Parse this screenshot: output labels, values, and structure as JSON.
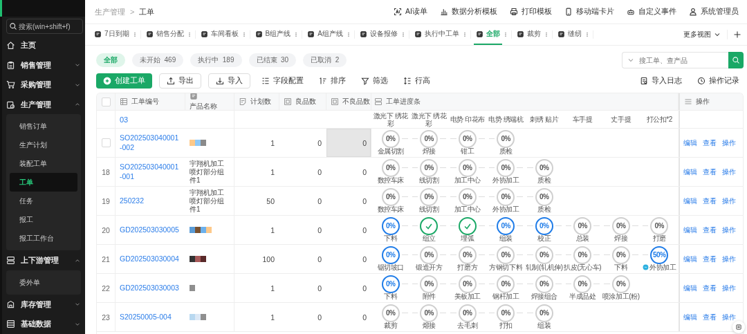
{
  "sidebar": {
    "search": {
      "placeholder": "搜索(win+shift+f)"
    },
    "items": [
      {
        "label": "主页",
        "kind": "link"
      },
      {
        "label": "销售管理",
        "kind": "group",
        "expanded": false
      },
      {
        "label": "采购管理",
        "kind": "group",
        "expanded": false
      },
      {
        "label": "生产管理",
        "kind": "group",
        "expanded": true,
        "children": [
          {
            "label": "销售订单",
            "selected": false
          },
          {
            "label": "生产计划",
            "selected": false
          },
          {
            "label": "装配工单",
            "selected": false
          },
          {
            "label": "工单",
            "selected": true
          },
          {
            "label": "任务",
            "selected": false
          },
          {
            "label": "报工",
            "selected": false
          },
          {
            "label": "报工工作台",
            "selected": false
          }
        ]
      },
      {
        "label": "上下游管理",
        "kind": "group",
        "expanded": true,
        "children": [
          {
            "label": "委外单",
            "selected": false
          }
        ]
      },
      {
        "label": "库存管理",
        "kind": "group",
        "expanded": false
      },
      {
        "label": "基础数据",
        "kind": "group",
        "expanded": false
      }
    ]
  },
  "breadcrumb": {
    "items": [
      "生产管理",
      "工单"
    ],
    "separator": ">"
  },
  "header_actions": [
    "AI读单",
    "数据分析模板",
    "打印模板",
    "移动端卡片",
    "自定义事件",
    "系统管理员"
  ],
  "view_tabs": [
    {
      "label": "7日到期",
      "selected": false
    },
    {
      "label": "销售分配",
      "selected": false
    },
    {
      "label": "车间看板",
      "selected": false
    },
    {
      "label": "B组产线",
      "selected": false
    },
    {
      "label": "A组产线",
      "selected": false
    },
    {
      "label": "设备报修",
      "selected": false
    },
    {
      "label": "执行中工单",
      "selected": false
    },
    {
      "label": "全部",
      "selected": true
    },
    {
      "label": "裁剪",
      "selected": false
    },
    {
      "label": "缝纫",
      "selected": false
    }
  ],
  "more_views": "更多视图",
  "status_filters": [
    {
      "label": "全部",
      "selected": true
    },
    {
      "label": "未开始",
      "count": "469",
      "selected": false
    },
    {
      "label": "执行中",
      "count": "189",
      "selected": false
    },
    {
      "label": "已结束",
      "count": "30",
      "selected": false
    },
    {
      "label": "已取消",
      "count": "2",
      "selected": false
    }
  ],
  "search": {
    "placeholder": "搜工单、查产品"
  },
  "toolbar": [
    {
      "label": "创建工单",
      "kind": "primary"
    },
    {
      "label": "导出",
      "kind": "outline"
    },
    {
      "label": "导入",
      "kind": "outline"
    },
    {
      "label": "字段配置",
      "kind": "text"
    },
    {
      "label": "排序",
      "kind": "text"
    },
    {
      "label": "筛选",
      "kind": "text"
    },
    {
      "label": "行高",
      "kind": "text"
    }
  ],
  "toolbar_right": [
    "导入日志",
    "操作记录"
  ],
  "table": {
    "select_all": {
      "checked": false
    },
    "columns": [
      "工单编号",
      "产品名称",
      "计划数",
      "良品数",
      "不良品数",
      "工单进度条",
      "操作"
    ],
    "rows": [
      {
        "kind": "partial",
        "id": "03",
        "steps": [
          {
            "label": "激光下 绣花彩"
          },
          {
            "label": "激光下 绣花彩"
          },
          {
            "label": "电势 印花布"
          },
          {
            "label": "电势 绣端杭"
          },
          {
            "label": "刺绣 贴片"
          },
          {
            "label": "车手提"
          },
          {
            "label": "丈手提"
          },
          {
            "label": "打公扣*2"
          }
        ]
      },
      {
        "kind": "full",
        "hovered": true,
        "checked": false,
        "id": "SO202503040001-002",
        "swatches": [
          {
            "color": "#fdc98a"
          },
          {
            "color": "#8ec9f9"
          },
          {
            "color": "#8a8a8a"
          }
        ],
        "planned": "1",
        "good": "0",
        "defective": "0",
        "actions": [
          "编辑",
          "查看",
          "操作"
        ],
        "steps": [
          {
            "label": "金属切割",
            "kind": "pending",
            "percent": "0%"
          },
          {
            "label": "焊接",
            "kind": "pending",
            "percent": "0%"
          },
          {
            "label": "钳工",
            "kind": "pending",
            "percent": "0%"
          },
          {
            "label": "质检",
            "kind": "pending",
            "percent": "0%"
          }
        ]
      },
      {
        "kind": "full",
        "hovered": false,
        "index": "18",
        "id": "SO202503040001-001",
        "product": "宇翔机加工喷灯部分组件1",
        "planned": "1",
        "good": "0",
        "defective": "0",
        "actions": [
          "编辑",
          "查看",
          "操作"
        ],
        "steps": [
          {
            "label": "数控车床",
            "kind": "pending",
            "percent": "0%"
          },
          {
            "label": "线切割",
            "kind": "pending",
            "percent": "0%"
          },
          {
            "label": "加工中心",
            "kind": "pending",
            "percent": "0%"
          },
          {
            "label": "外协加工",
            "kind": "pending",
            "percent": "0%"
          },
          {
            "label": "质检",
            "kind": "pending",
            "percent": "0%"
          }
        ]
      },
      {
        "kind": "full",
        "hovered": false,
        "index": "19",
        "id": "250232",
        "product": "宇翔机加工喷灯部分组件1",
        "planned": "50",
        "good": "0",
        "defective": "0",
        "actions": [
          "编辑",
          "查看",
          "操作"
        ],
        "steps": [
          {
            "label": "数控车床",
            "kind": "pending",
            "percent": "0%"
          },
          {
            "label": "线切割",
            "kind": "pending",
            "percent": "0%"
          },
          {
            "label": "加工中心",
            "kind": "pending",
            "percent": "0%"
          },
          {
            "label": "外协加工",
            "kind": "pending",
            "percent": "0%"
          },
          {
            "label": "质检",
            "kind": "pending",
            "percent": "0%"
          }
        ]
      },
      {
        "kind": "full",
        "hovered": false,
        "index": "20",
        "id": "GD202503030005",
        "swatches": [
          {
            "color": "#5b9bd5"
          },
          {
            "color": "#7a5230"
          },
          {
            "color": "#6cb0ec"
          },
          {
            "color": "#fdc98a"
          }
        ],
        "planned": "1",
        "good": "0",
        "defective": "0",
        "actions": [
          "编辑",
          "查看",
          "操作"
        ],
        "steps": [
          {
            "label": "下料",
            "kind": "active",
            "percent": "0%"
          },
          {
            "label": "组立",
            "kind": "done"
          },
          {
            "label": "埋弧",
            "kind": "done"
          },
          {
            "label": "组装",
            "kind": "active",
            "percent": "0%"
          },
          {
            "label": "校正",
            "kind": "active",
            "percent": "0%"
          },
          {
            "label": "总装",
            "kind": "pending",
            "percent": "0%"
          },
          {
            "label": "焊接",
            "kind": "pending",
            "percent": "0%"
          },
          {
            "label": "打磨",
            "kind": "pending",
            "percent": "0%"
          }
        ]
      },
      {
        "kind": "full",
        "hovered": false,
        "index": "21",
        "id": "GD202503030004",
        "swatches": [
          {
            "color": "#333333"
          },
          {
            "color": "#a85a5a"
          },
          {
            "color": "#5a2a2a"
          }
        ],
        "planned": "100",
        "good": "0",
        "defective": "0",
        "actions": [
          "编辑",
          "查看",
          "操作"
        ],
        "steps": [
          {
            "label": "锯切坡口",
            "kind": "active",
            "percent": "0%"
          },
          {
            "label": "锻造开方",
            "kind": "pending",
            "percent": "0%"
          },
          {
            "label": "打磨方",
            "kind": "pending",
            "percent": "0%"
          },
          {
            "label": "方钢切下料",
            "kind": "pending",
            "percent": "0%"
          },
          {
            "label": "轧制(轧机伸)",
            "kind": "pending",
            "percent": "0%"
          },
          {
            "label": "扒皮(无心车)",
            "kind": "pending",
            "percent": "0%"
          },
          {
            "label": "下料",
            "kind": "pending",
            "percent": "0%"
          },
          {
            "label": "外协加工",
            "kind": "active",
            "percent": "50%",
            "outsourced": true
          }
        ]
      },
      {
        "kind": "full",
        "hovered": false,
        "index": "22",
        "id": "GD202503030003",
        "swatches": [
          {
            "color": "#8f8f8f"
          }
        ],
        "planned": "1",
        "good": "0",
        "defective": "0",
        "actions": [
          "编辑",
          "查看",
          "操作"
        ],
        "steps": [
          {
            "label": "下料",
            "kind": "active",
            "percent": "0%"
          },
          {
            "label": "附件",
            "kind": "pending",
            "percent": "0%"
          },
          {
            "label": "美板加工",
            "kind": "pending",
            "percent": "0%"
          },
          {
            "label": "钢杆加工",
            "kind": "pending",
            "percent": "0%"
          },
          {
            "label": "焊接组合",
            "kind": "pending",
            "percent": "0%"
          },
          {
            "label": "半成品处",
            "kind": "pending",
            "percent": "0%"
          },
          {
            "label": "喷涂加工(粉)",
            "kind": "pending",
            "percent": "0%"
          }
        ]
      },
      {
        "kind": "full",
        "hovered": false,
        "index": "23",
        "id": "S20250005-004",
        "swatches": [
          {
            "color": "#b8d8f0"
          },
          {
            "color": "#dce8f5"
          },
          {
            "color": "#8f8f8f"
          }
        ],
        "planned": "1",
        "good": "0",
        "defective": "0",
        "actions": [
          "编辑",
          "查看",
          "操作"
        ],
        "steps": [
          {
            "label": "裁剪",
            "kind": "pending",
            "percent": "0%"
          },
          {
            "label": "熔接",
            "kind": "pending",
            "percent": "0%"
          },
          {
            "label": "去毛刺",
            "kind": "pending",
            "percent": "0%"
          },
          {
            "label": "打扣",
            "kind": "pending",
            "percent": "0%"
          },
          {
            "label": "组装",
            "kind": "pending",
            "percent": "0%"
          }
        ]
      }
    ]
  }
}
